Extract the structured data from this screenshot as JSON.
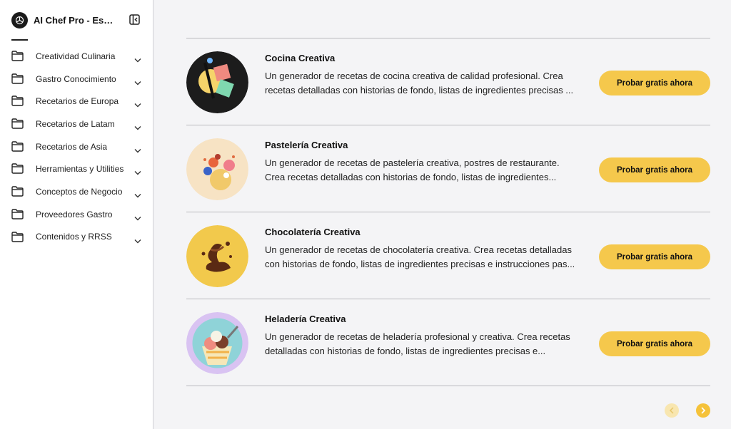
{
  "sidebar": {
    "brand_title": "AI Chef Pro - Españ...",
    "items": [
      {
        "label": "Creatividad Culinaria"
      },
      {
        "label": "Gastro Conocimiento"
      },
      {
        "label": "Recetarios de Europa"
      },
      {
        "label": "Recetarios de Latam"
      },
      {
        "label": "Recetarios de Asia"
      },
      {
        "label": "Herramientas y Utilities"
      },
      {
        "label": "Conceptos de Negocio"
      },
      {
        "label": "Proveedores Gastro"
      },
      {
        "label": "Contenidos y RRSS"
      }
    ]
  },
  "cards": [
    {
      "title": "Cocina Creativa",
      "description": "Un generador de recetas de cocina creativa de calidad profesional. Crea recetas detalladas con historias de fondo, listas de ingredientes precisas ...",
      "cta": "Probar gratis ahora"
    },
    {
      "title": "Pastelería Creativa",
      "description": "Un generador de recetas de pastelería creativa, postres de restaurante. Crea recetas detalladas con historias de fondo, listas de ingredientes...",
      "cta": "Probar gratis ahora"
    },
    {
      "title": "Chocolatería Creativa",
      "description": "Un generador de recetas de chocolatería creativa. Crea recetas detalladas con historias de fondo, listas de ingredientes precisas e instrucciones pas...",
      "cta": "Probar gratis ahora"
    },
    {
      "title": "Heladería Creativa",
      "description": "Un generador de recetas de heladería profesional y creativa. Crea recetas detalladas con historias de fondo, listas de ingredientes precisas e...",
      "cta": "Probar gratis ahora"
    }
  ],
  "colors": {
    "accent": "#f5c84c",
    "background": "#f4f4f6",
    "sidebar": "#ffffff"
  },
  "icons": {
    "brand": "openai-logo-icon",
    "collapse": "sidebar-collapse-icon",
    "folder": "folder-icon",
    "chevron": "chevron-down-icon",
    "prev": "chevron-left-icon",
    "next": "chevron-right-icon"
  }
}
